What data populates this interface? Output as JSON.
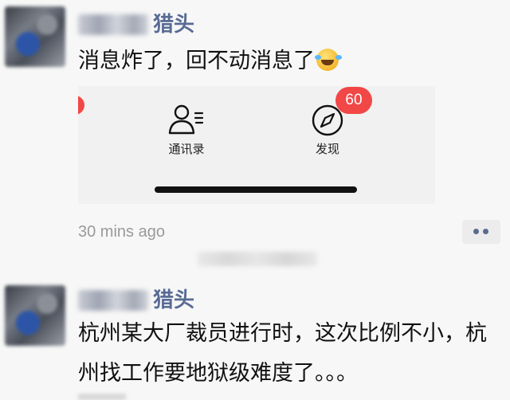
{
  "posts": [
    {
      "author": "猎头",
      "text": "消息炸了，回不动消息了",
      "emoji": "rofl-emoji",
      "screenshot": {
        "tabs": [
          {
            "label": "通讯录",
            "icon": "contacts-icon"
          },
          {
            "label": "发现",
            "icon": "compass-icon"
          }
        ],
        "badge": "60",
        "badge_color": "#f24747"
      },
      "timestamp": "30 mins ago"
    },
    {
      "author": "猎头",
      "text_lines": [
        "杭州某大厂裁员进行时，这次比例不小，杭",
        "州找工作要地狱级难度了。。。"
      ]
    }
  ],
  "colors": {
    "author_name": "#586b95",
    "timestamp": "#9a9a9a",
    "background": "#f7f7f7"
  }
}
